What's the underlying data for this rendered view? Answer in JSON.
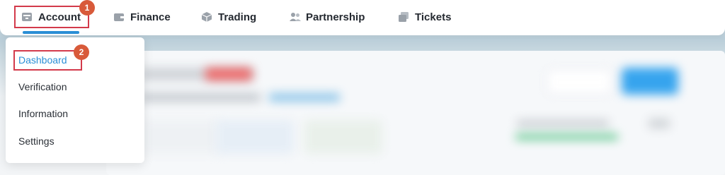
{
  "nav": {
    "items": [
      {
        "label": "Account",
        "icon": "account-icon"
      },
      {
        "label": "Finance",
        "icon": "wallet-icon"
      },
      {
        "label": "Trading",
        "icon": "cube-icon"
      },
      {
        "label": "Partnership",
        "icon": "partners-icon"
      },
      {
        "label": "Tickets",
        "icon": "tickets-icon"
      }
    ],
    "active_color": "#2b8fd6"
  },
  "dropdown": {
    "items": [
      {
        "label": "Dashboard",
        "active": true
      },
      {
        "label": "Verification"
      },
      {
        "label": "Information"
      },
      {
        "label": "Settings"
      }
    ]
  },
  "annotations": {
    "step1": "1",
    "step2": "2",
    "highlight_color": "#d33a4b",
    "marker_color": "#d85a3a"
  }
}
